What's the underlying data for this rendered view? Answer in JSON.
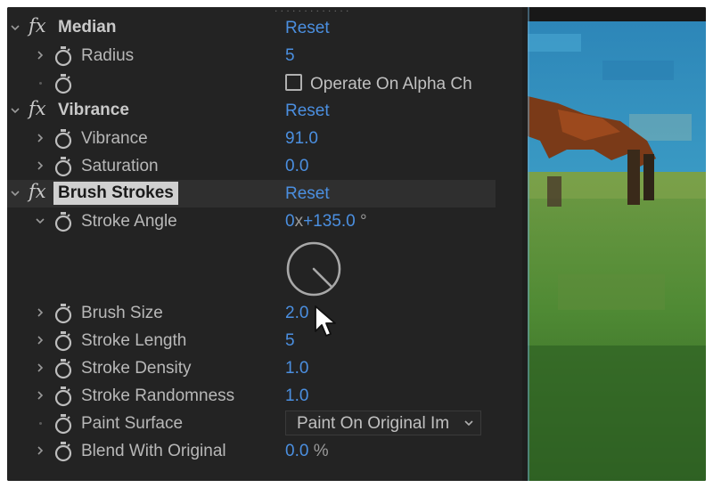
{
  "effects": {
    "median": {
      "name": "Median",
      "reset": "Reset",
      "radius": {
        "label": "Radius",
        "value": "5"
      },
      "alpha": {
        "label": "Operate On Alpha Ch",
        "checked": false
      }
    },
    "vibrance": {
      "name": "Vibrance",
      "reset": "Reset",
      "vibrance": {
        "label": "Vibrance",
        "value": "91.0"
      },
      "saturation": {
        "label": "Saturation",
        "value": "0.0"
      }
    },
    "brush_strokes": {
      "name": "Brush Strokes",
      "reset": "Reset",
      "stroke_angle": {
        "label": "Stroke Angle",
        "turns": "0",
        "x": "x",
        "degrees": "+135.0",
        "deg_unit": "°"
      },
      "brush_size": {
        "label": "Brush Size",
        "value": "2.0"
      },
      "stroke_length": {
        "label": "Stroke Length",
        "value": "5"
      },
      "stroke_density": {
        "label": "Stroke Density",
        "value": "1.0"
      },
      "stroke_randomness": {
        "label": "Stroke Randomness",
        "value": "1.0"
      },
      "paint_surface": {
        "label": "Paint Surface",
        "value": "Paint On Original Im"
      },
      "blend": {
        "label": "Blend With Original",
        "value": "0.0",
        "unit": "%"
      }
    }
  },
  "colors": {
    "panel_bg": "#232323",
    "value_blue": "#4b8fe0",
    "label_gray": "#b8b8b8"
  }
}
